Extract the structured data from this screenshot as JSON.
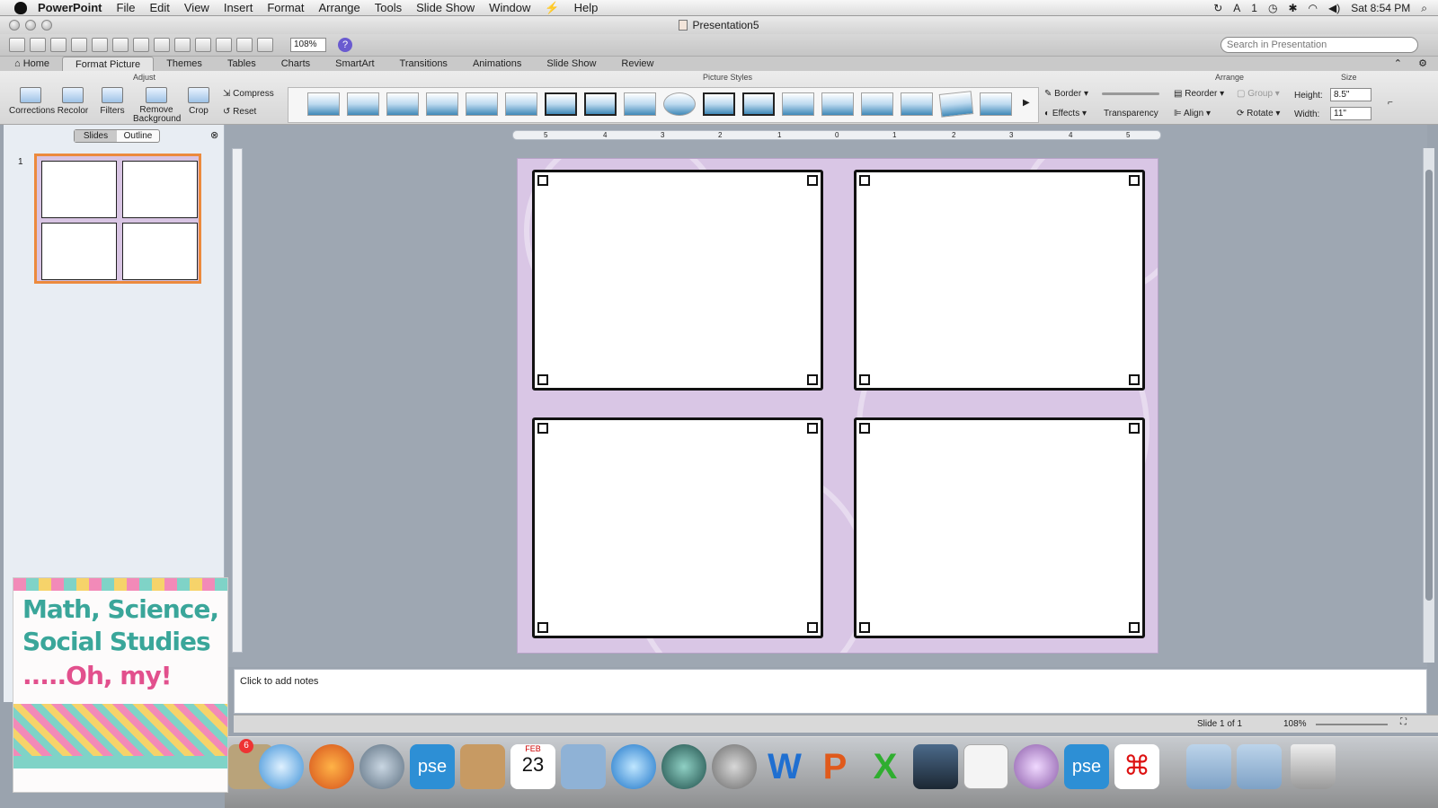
{
  "menubar": {
    "app": "PowerPoint",
    "items": [
      "File",
      "Edit",
      "View",
      "Insert",
      "Format",
      "Arrange",
      "Tools",
      "Slide Show",
      "Window",
      "Help"
    ],
    "status_badge": "1",
    "clock": "Sat 8:54 PM"
  },
  "window": {
    "title": "Presentation5"
  },
  "toolbar": {
    "zoom": "108%",
    "search_placeholder": "Search in Presentation",
    "help_glyph": "?"
  },
  "ribbon": {
    "tabs": [
      "Home",
      "Format Picture",
      "Themes",
      "Tables",
      "Charts",
      "SmartArt",
      "Transitions",
      "Animations",
      "Slide Show",
      "Review"
    ],
    "active_tab": "Format Picture",
    "groups": {
      "adjust": "Adjust",
      "picture_styles": "Picture Styles",
      "arrange": "Arrange",
      "size": "Size"
    },
    "adjust": {
      "corrections": "Corrections",
      "recolor": "Recolor",
      "filters": "Filters",
      "remove_bg_1": "Remove",
      "remove_bg_2": "Background",
      "crop": "Crop",
      "compress": "Compress",
      "reset": "Reset"
    },
    "styles": {
      "border": "Border",
      "effects": "Effects",
      "transparency": "Transparency"
    },
    "arrange": {
      "reorder": "Reorder",
      "group": "Group",
      "align": "Align",
      "rotate": "Rotate"
    },
    "size": {
      "height_label": "Height:",
      "height_value": "8.5\"",
      "width_label": "Width:",
      "width_value": "11\""
    }
  },
  "left_pane": {
    "seg_slides": "Slides",
    "seg_outline": "Outline",
    "slide_number": "1"
  },
  "ruler": {
    "labels": [
      "5",
      "4",
      "3",
      "2",
      "1",
      "0",
      "1",
      "2",
      "3",
      "4",
      "5"
    ]
  },
  "notes": {
    "placeholder": "Click to add notes"
  },
  "status": {
    "slide_info": "Slide 1 of 1",
    "zoom": "108%"
  },
  "logo": {
    "line1": "Math, Science,",
    "line2": "Social Studies",
    "line3": ".....Oh, my!"
  },
  "dock": {
    "badge": "6",
    "apps": [
      "Mail",
      "Safari",
      "Firefox",
      "iChat",
      "Photoshop Elements",
      "Address Book",
      "Calendar",
      "iPhoto",
      "iTunes",
      "Time Machine",
      "System Preferences",
      "Word",
      "PowerPoint",
      "Excel",
      "Spy",
      "TextEdit",
      "Script",
      "Photoshop Elements",
      "Acrobat",
      "Documents",
      "Applications",
      "Trash"
    ],
    "calendar_day": "23",
    "calendar_month": "FEB",
    "pse_label": "pse"
  },
  "colors": {
    "slide_bg": "#d9c6e5",
    "accent_orange": "#ec8a3d",
    "ribbon_bg": "#e4e4e4"
  }
}
